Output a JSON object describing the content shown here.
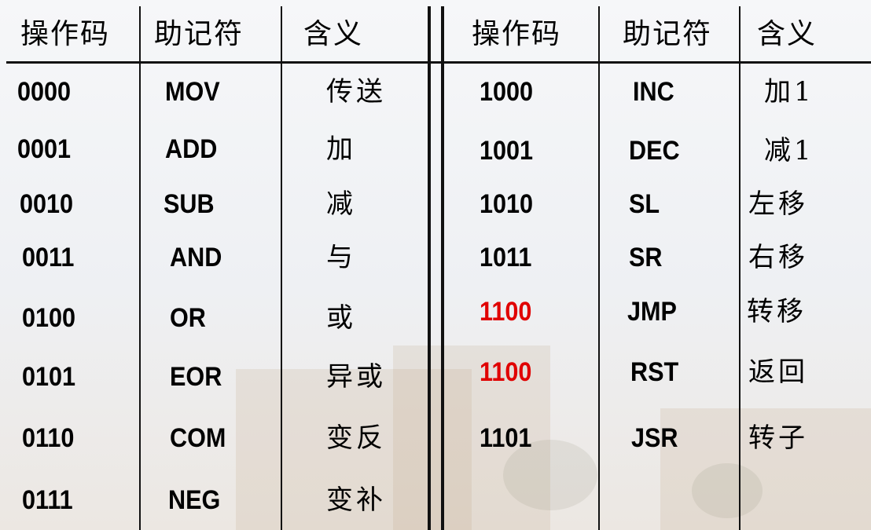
{
  "headers": {
    "left": [
      "操作码",
      "助记符",
      "含义"
    ],
    "right": [
      "操作码",
      "助记符",
      "含义"
    ]
  },
  "left_rows": [
    {
      "opcode": "0000",
      "mnemonic": "MOV",
      "meaning": "传送"
    },
    {
      "opcode": "0001",
      "mnemonic": "ADD",
      "meaning": "加"
    },
    {
      "opcode": "0010",
      "mnemonic": "SUB",
      "meaning": "减"
    },
    {
      "opcode": "0011",
      "mnemonic": "AND",
      "meaning": "与"
    },
    {
      "opcode": "0100",
      "mnemonic": "OR",
      "meaning": "或"
    },
    {
      "opcode": "0101",
      "mnemonic": "EOR",
      "meaning": "异或"
    },
    {
      "opcode": "0110",
      "mnemonic": "COM",
      "meaning": "变反"
    },
    {
      "opcode": "0111",
      "mnemonic": "NEG",
      "meaning": "变补"
    }
  ],
  "right_rows": [
    {
      "opcode": "1000",
      "mnemonic": "INC",
      "meaning": "加1"
    },
    {
      "opcode": "1001",
      "mnemonic": "DEC",
      "meaning": "减1"
    },
    {
      "opcode": "1010",
      "mnemonic": "SL",
      "meaning": "左移"
    },
    {
      "opcode": "1011",
      "mnemonic": "SR",
      "meaning": "右移"
    },
    {
      "opcode": "1100",
      "mnemonic": "JMP",
      "meaning": "转移"
    },
    {
      "opcode": "1100",
      "mnemonic": "RST",
      "meaning": "返回"
    },
    {
      "opcode": "1101",
      "mnemonic": "JSR",
      "meaning": "转子"
    }
  ],
  "colors": {
    "highlight": "#e00000",
    "text": "#000000",
    "rule": "#111111"
  }
}
